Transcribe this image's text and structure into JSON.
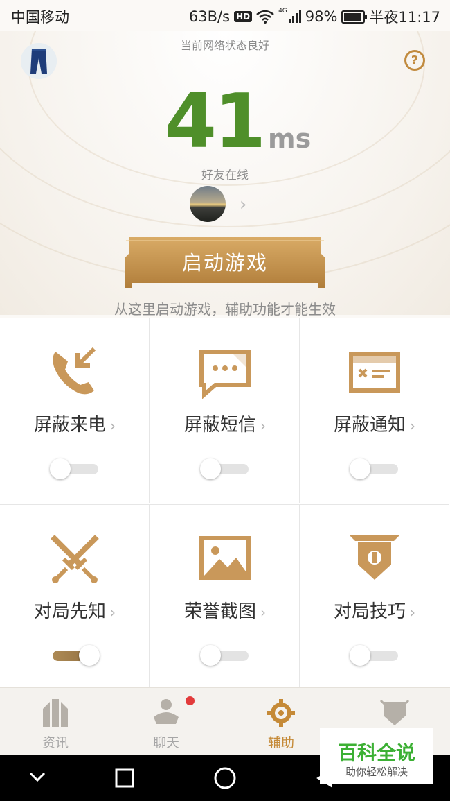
{
  "status_bar": {
    "carrier": "中国移动",
    "net_speed": "63B/s",
    "hd": "HD",
    "signal_label": "4G",
    "battery": "98%",
    "time": "半夜11:17"
  },
  "header": {
    "network_status": "当前网络状态良好",
    "help_symbol": "?",
    "ping_value": "41",
    "ping_unit": "ms",
    "friends_online": "好友在线",
    "friend_arrow": "›"
  },
  "start": {
    "button_label": "启动游戏",
    "hint": "从这里启动游戏，辅助功能才能生效"
  },
  "features": [
    {
      "label": "屏蔽来电",
      "icon": "phone-block-icon",
      "enabled": false
    },
    {
      "label": "屏蔽短信",
      "icon": "message-block-icon",
      "enabled": false
    },
    {
      "label": "屏蔽通知",
      "icon": "notification-block-icon",
      "enabled": false
    },
    {
      "label": "对局先知",
      "icon": "crossed-swords-icon",
      "enabled": true
    },
    {
      "label": "荣誉截图",
      "icon": "picture-icon",
      "enabled": false
    },
    {
      "label": "对局技巧",
      "icon": "banner-icon",
      "enabled": false
    }
  ],
  "chevron": "›",
  "tabs": [
    {
      "label": "资讯",
      "active": false
    },
    {
      "label": "聊天",
      "active": false,
      "badge": true
    },
    {
      "label": "辅助",
      "active": true
    },
    {
      "label": "",
      "active": false
    }
  ],
  "watermark": {
    "title": "百科全说",
    "subtitle": "助你轻松解决"
  },
  "colors": {
    "accent": "#c58a37",
    "ping": "#4f8f2a",
    "badge": "#e23b3b",
    "gold": "#c9985a"
  }
}
